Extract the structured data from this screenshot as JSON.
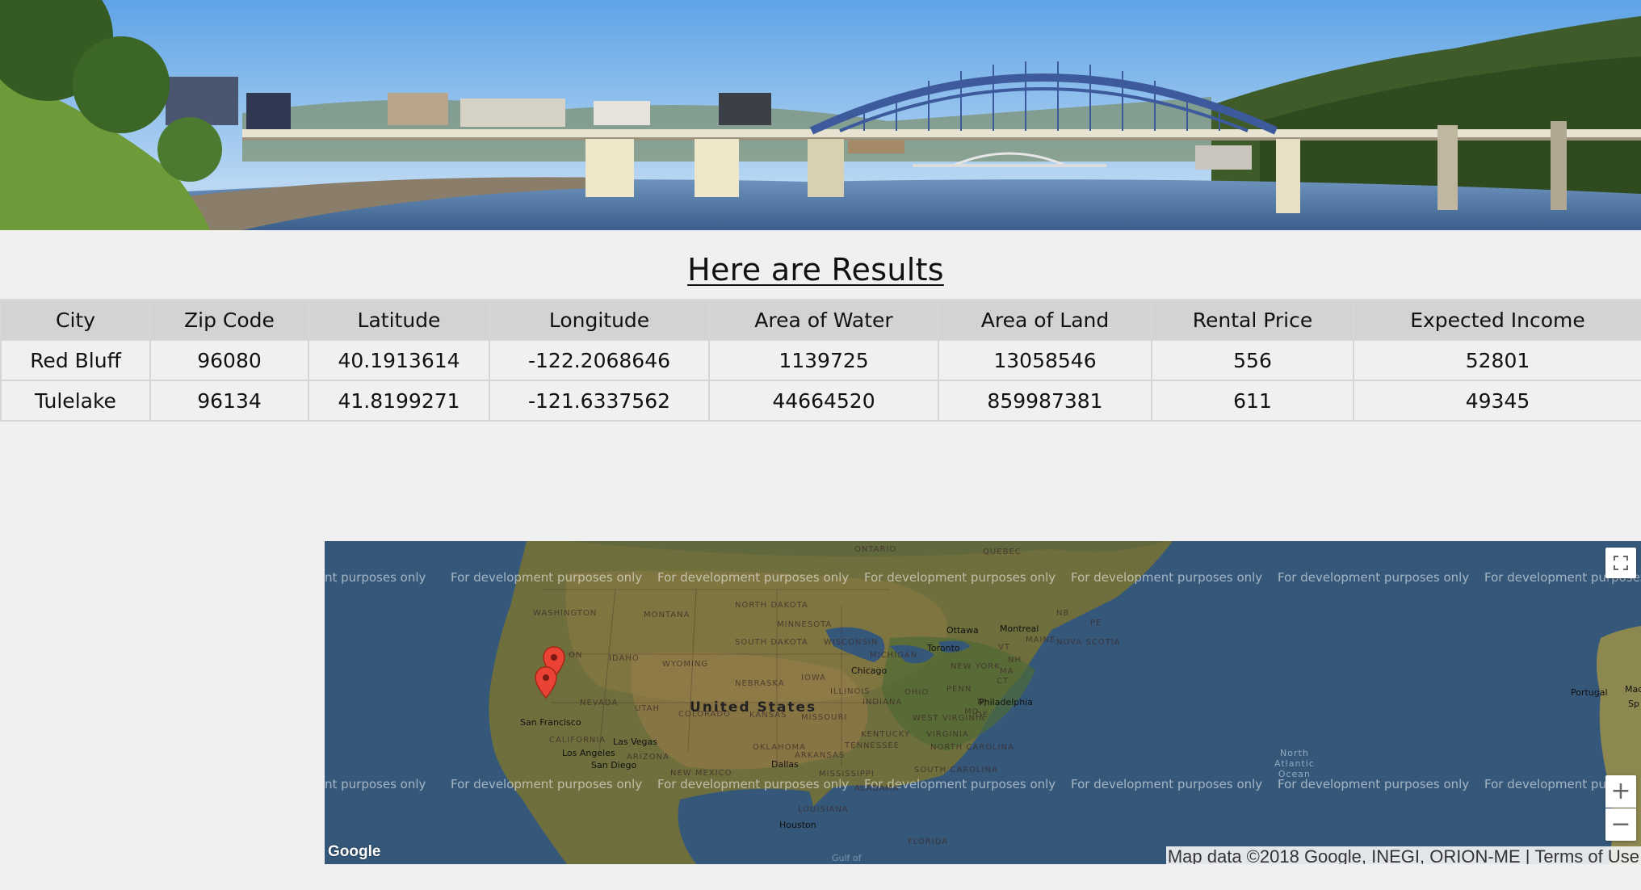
{
  "banner": {
    "alt": "River bridge skyline banner"
  },
  "results": {
    "title": "Here are Results",
    "columns": [
      "City",
      "Zip Code",
      "Latitude",
      "Longitude",
      "Area of Water",
      "Area of Land",
      "Rental Price",
      "Expected Income"
    ],
    "rows": [
      [
        "Red Bluff",
        "96080",
        "40.1913614",
        "-122.2068646",
        "1139725",
        "13058546",
        "556",
        "52801"
      ],
      [
        "Tulelake",
        "96134",
        "41.8199271",
        "-121.6337562",
        "44664520",
        "859987381",
        "611",
        "49345"
      ]
    ]
  },
  "map": {
    "watermark": "For development purposes only",
    "watermark_clipped_left": "nt purposes only",
    "watermark_clipped_right": "For development purposes o",
    "watermark_clipped_right2": "For development pu",
    "country_label": "United States",
    "ocean_label": [
      "North",
      "Atlantic",
      "Ocean"
    ],
    "state_labels": [
      "ONTARIO",
      "QUEBEC",
      "WASHINGTON",
      "MONTANA",
      "NORTH DAKOTA",
      "MINNESOTA",
      "ON",
      "IDAHO",
      "SOUTH DAKOTA",
      "WISCONSIN",
      "MICHIGAN",
      "WYOMING",
      "IOWA",
      "NEBRASKA",
      "ILLINOIS",
      "NEVADA",
      "UTAH",
      "COLORADO",
      "KANSAS",
      "MISSOURI",
      "INDIANA",
      "OHIO",
      "PENN",
      "NEW YORK",
      "MAINE",
      "NOVA SCOTIA",
      "CALIFORNIA",
      "OKLAHOMA",
      "ARKANSAS",
      "TENNESSEE",
      "KENTUCKY",
      "WEST VIRGINIA",
      "VIRGINIA",
      "NORTH CAROLINA",
      "SOUTH CAROLINA",
      "ARIZONA",
      "NEW MEXICO",
      "MISSISSIPPI",
      "ALABAMA",
      "LOUISIANA",
      "FLORIDA",
      "NB",
      "PE",
      "VT",
      "NH",
      "MA",
      "CT",
      "MD",
      "DE",
      "NJ"
    ],
    "city_labels": [
      "Ottawa",
      "Montreal",
      "Toronto",
      "Chicago",
      "Philadelphia",
      "San Francisco",
      "Las Vegas",
      "Los Angeles",
      "San Diego",
      "Dallas",
      "Houston",
      "Portugal",
      "Mad",
      "Sp"
    ],
    "gulf_label": "Gulf of",
    "attribution": "Map data ©2018 Google, INEGI, ORION-ME",
    "terms": "Terms of Use",
    "google_logo": "Google",
    "zoom_in": "+",
    "zoom_out": "−",
    "fullscreen_icon": "fullscreen-icon",
    "marker_color": "#ea4335"
  }
}
